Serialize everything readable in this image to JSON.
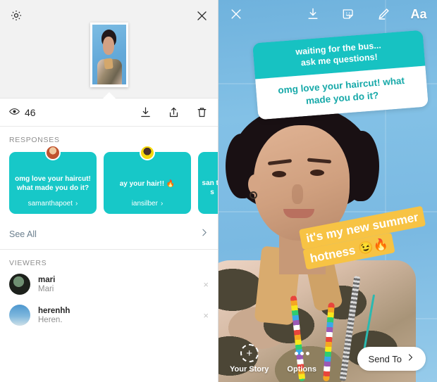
{
  "insights_panel": {
    "settings_icon": "gear-icon",
    "close_icon": "close-icon",
    "story_thumbnail_alt": "story-thumbnail",
    "stats": {
      "views_icon": "eye-icon",
      "views_count": "46",
      "actions": [
        {
          "icon": "download-icon",
          "label": "Download"
        },
        {
          "icon": "share-icon",
          "label": "Share"
        },
        {
          "icon": "trash-icon",
          "label": "Delete"
        }
      ]
    },
    "responses": {
      "section_label": "RESPONSES",
      "cards": [
        {
          "text": "omg love your haircut! what made you do it?",
          "username": "samanthapoet",
          "chevron": "›",
          "avatar": "avatar-samanthapoet"
        },
        {
          "text": "ay your hair!! 🔥",
          "username": "iansilber",
          "chevron": "›",
          "avatar": "avatar-iansilber"
        },
        {
          "text": "san te s",
          "username": "",
          "chevron": "",
          "avatar": "avatar-partial"
        }
      ],
      "see_all_label": "See All",
      "see_all_chevron": "›"
    },
    "viewers": {
      "section_label": "VIEWERS",
      "rows": [
        {
          "username": "mari",
          "fullname": "Mari",
          "dismiss_icon": "×",
          "avatar": "avatar-mari"
        },
        {
          "username": "herenhh",
          "fullname": "Heren.",
          "dismiss_icon": "×",
          "avatar": "avatar-herenhh"
        }
      ]
    }
  },
  "story_panel": {
    "top_bar": {
      "close_icon": "close-icon",
      "tools": [
        {
          "icon": "download-icon",
          "label": "Save"
        },
        {
          "icon": "sticker-icon",
          "label": "Stickers"
        },
        {
          "icon": "pen-icon",
          "label": "Draw"
        },
        {
          "icon": "text-icon",
          "label": "Aa"
        }
      ]
    },
    "question_sticker": {
      "prompt_line1": "waiting for the bus...",
      "prompt_line2": "ask me questions!",
      "answer_line1": "omg love your haircut! what",
      "answer_line2": "made you do it?"
    },
    "caption_sticker": {
      "line1": "it's my new summer",
      "line2": "hotness  😉🔥"
    },
    "bottom_bar": {
      "your_story_label": "Your Story",
      "your_story_icon": "plus-circle-icon",
      "options_label": "Options",
      "options_icon": "ellipsis-icon",
      "send_to_label": "Send To",
      "send_to_chevron": "›"
    }
  },
  "colors": {
    "teal": "#17c8c8",
    "teal_text": "#17a9a9",
    "yellow": "#f7c344",
    "panel_bg": "#f2f2f2",
    "link_blue": "#6b7f8e",
    "muted": "#8e8e8e",
    "sky": "#7ec0e8"
  }
}
